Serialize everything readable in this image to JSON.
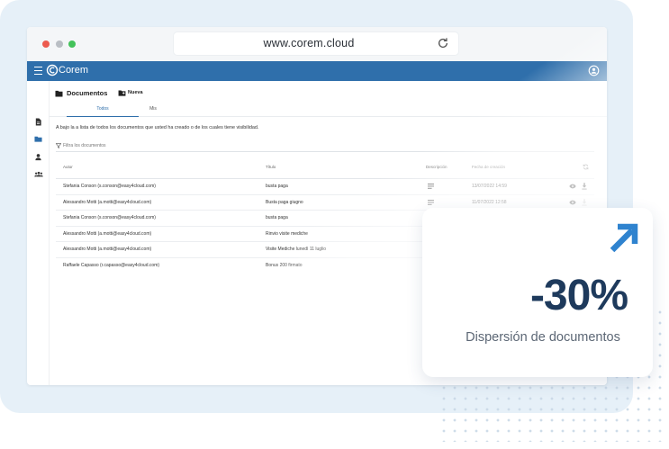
{
  "browser": {
    "url": "www.corem.cloud"
  },
  "app": {
    "brand": "Corem",
    "header_title": "Documentos",
    "new_button_label": "Nueva",
    "tabs": [
      {
        "label": "Todos",
        "active": true
      },
      {
        "label": "Mis",
        "active": false
      }
    ],
    "info_text": "A bajo la a lista de todos los documentos que usted ha creado o de los cuales tiene visibilidad.",
    "filter_placeholder": "Filtra los documentos",
    "table": {
      "columns": [
        "Autor",
        "Título",
        "Descripción",
        "Fecha de creación"
      ],
      "rows": [
        {
          "autor": "Stefania Conson (s.conson@easy4cloud.com)",
          "titulo": "busta paga",
          "fecha": "13/07/2022 14:59",
          "has_description": true
        },
        {
          "autor": "Alessandro Motti (a.motti@easy4cloud.com)",
          "titulo": "Busta paga giugno",
          "fecha": "11/07/2022 12:58",
          "has_description": true
        },
        {
          "autor": "Stefania Conson (s.conson@easy4cloud.com)",
          "titulo": "busta paga",
          "fecha": "",
          "has_description": false
        },
        {
          "autor": "Alessandro Motti (a.motti@easy4cloud.com)",
          "titulo": "Rinvio visite mediche",
          "fecha": "",
          "has_description": false
        },
        {
          "autor": "Alessandro Motti (a.motti@easy4cloud.com)",
          "titulo": "Visite Mediche lunedì 11 luglio",
          "fecha": "",
          "has_description": false
        },
        {
          "autor": "Raffaele Capasso (r.capasso@easy4cloud.com)",
          "titulo": "Bonus 200 firmato",
          "fecha": "",
          "has_description": false
        }
      ]
    },
    "icons": {
      "nav": [
        "document-icon",
        "folder-icon",
        "person-icon",
        "group-icon"
      ],
      "header": "folder-icon",
      "row_actions": [
        "eye-icon",
        "download-icon"
      ],
      "table_action": "sync-icon"
    }
  },
  "stat": {
    "value": "-30%",
    "label": "Dispersión de documentos"
  },
  "colors": {
    "primary": "#2f6fab",
    "accent_arrow": "#2f83cf",
    "stat_text": "#1e3a5c"
  }
}
